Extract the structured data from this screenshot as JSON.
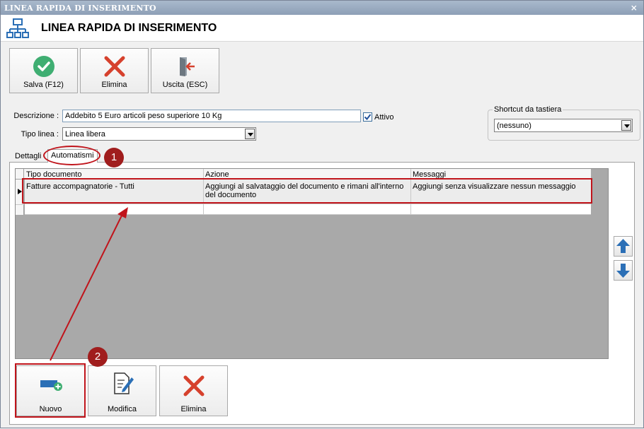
{
  "window": {
    "title": "LINEA RAPIDA DI INSERIMENTO",
    "close": "×"
  },
  "header": {
    "title": "LINEA RAPIDA DI INSERIMENTO",
    "icon": "sitemap-icon"
  },
  "toolbar": {
    "save_label": "Salva (F12)",
    "delete_label": "Elimina",
    "exit_label": "Uscita (ESC)"
  },
  "form": {
    "descrizione_label": "Descrizione :",
    "descrizione_value": "Addebito 5 Euro articoli peso superiore 10 Kg",
    "attivo_label": "Attivo",
    "attivo_checked": true,
    "tipo_linea_label": "Tipo linea :",
    "tipo_linea_value": "Linea libera",
    "shortcut_group": "Shortcut da tastiera",
    "shortcut_value": "(nessuno)"
  },
  "tabs": [
    {
      "label": "Dettagli",
      "active": false
    },
    {
      "label": "Automatismi",
      "active": true
    }
  ],
  "grid": {
    "columns": [
      "Tipo documento",
      "Azione",
      "Messaggi"
    ],
    "rows": [
      {
        "tipo": "Fatture accompagnatorie - Tutti",
        "azione": "Aggiungi al salvataggio del documento e rimani all'interno del documento",
        "messaggi": "Aggiungi senza visualizzare nessun messaggio"
      }
    ]
  },
  "bottom_buttons": {
    "new_label": "Nuovo",
    "edit_label": "Modifica",
    "delete_label": "Elimina"
  },
  "annotations": {
    "badge1": "1",
    "badge2": "2"
  },
  "colors": {
    "highlight": "#c0141b",
    "badge": "#a01d1d",
    "grid_bg": "#a9a9a9",
    "accent": "#2b6fb6"
  }
}
